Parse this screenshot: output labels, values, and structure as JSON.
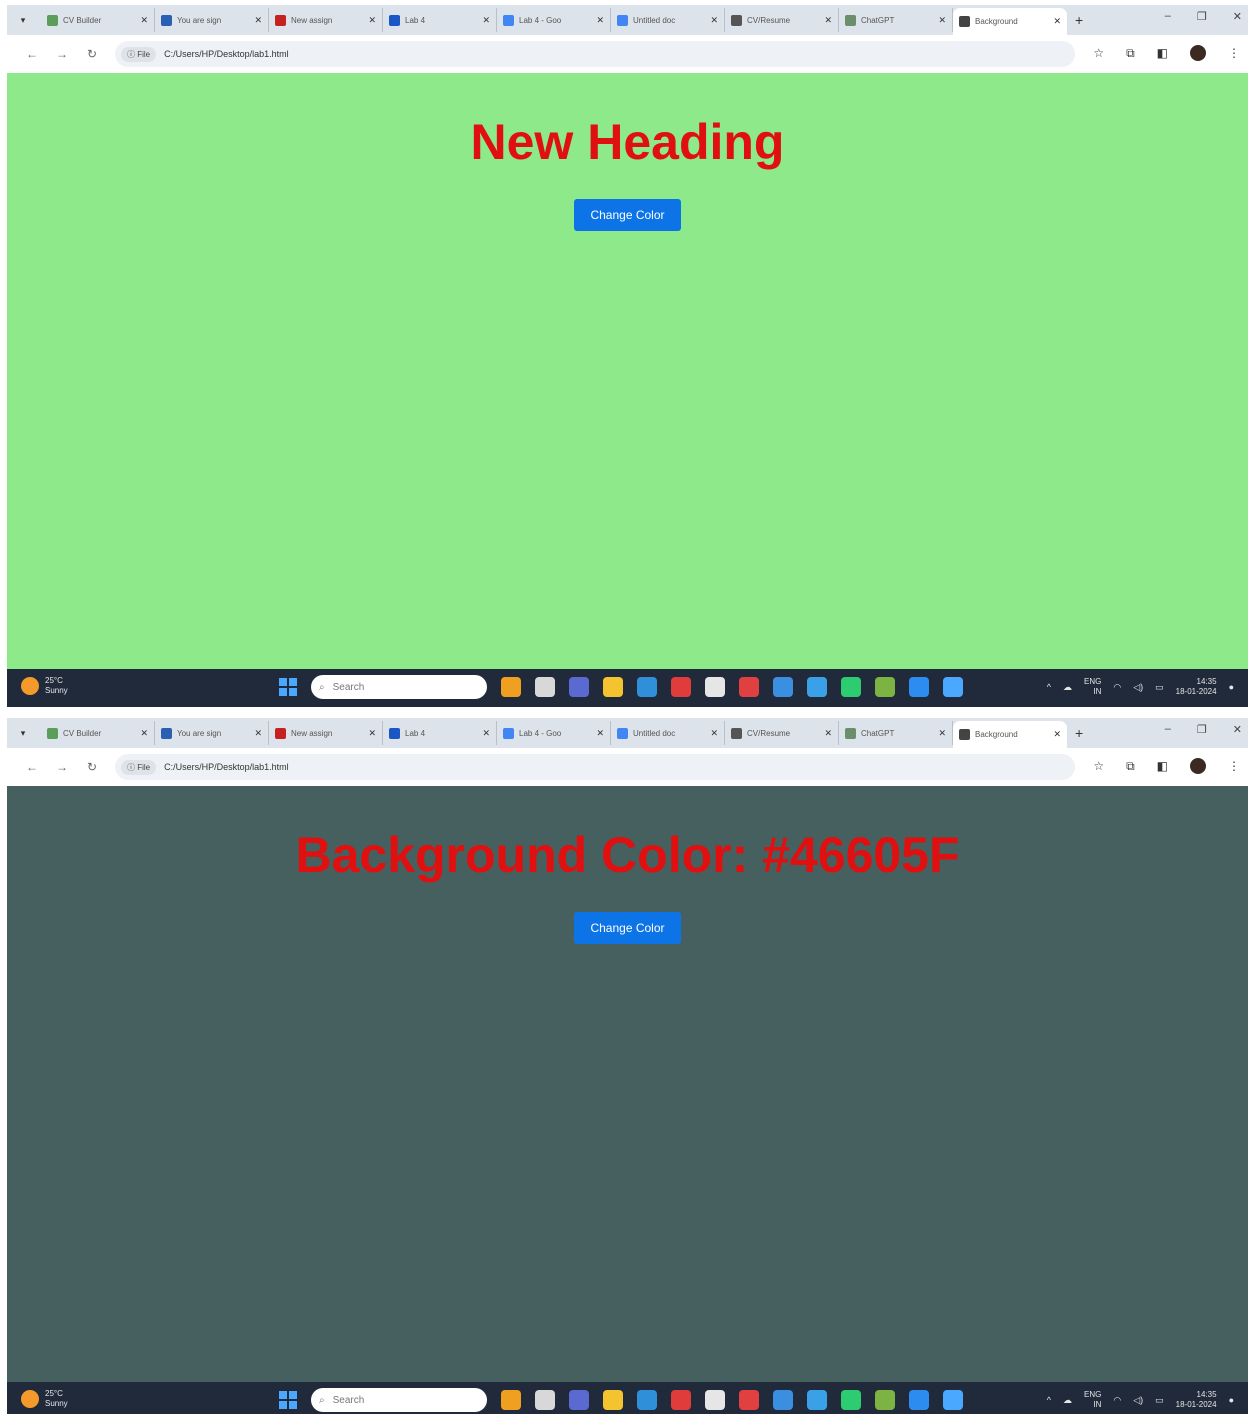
{
  "browser": {
    "tabs": [
      {
        "title": "CV Builder",
        "favicon_color": "#5a9e5a"
      },
      {
        "title": "You are sign",
        "favicon_color": "#2a5fb4"
      },
      {
        "title": "New assign",
        "favicon_color": "#c5221f"
      },
      {
        "title": "Lab 4",
        "favicon_color": "#1a56c4"
      },
      {
        "title": "Lab 4 - Goo",
        "favicon_color": "#4285f4"
      },
      {
        "title": "Untitled doc",
        "favicon_color": "#4285f4"
      },
      {
        "title": "CV/Resume",
        "favicon_color": "#555555"
      },
      {
        "title": "ChatGPT",
        "favicon_color": "#6b8e6b"
      },
      {
        "title": "Background",
        "favicon_color": "#444444"
      }
    ],
    "site_chip": "File",
    "url": "C:/Users/HP/Desktop/lab1.html"
  },
  "screens": [
    {
      "heading": "New Heading",
      "bg_color": "#8ee98a",
      "button_label": "Change Color"
    },
    {
      "heading": "Background Color: #46605F",
      "bg_color": "#46605f",
      "button_label": "Change Color"
    }
  ],
  "taskbar": {
    "temp": "25°C",
    "condition": "Sunny",
    "search_placeholder": "Search",
    "lang_top": "ENG",
    "lang_bottom": "IN",
    "time": "14:35",
    "date": "18-01-2024",
    "app_colors": [
      "#f0a020",
      "#d8d8d8",
      "#5b6ad0",
      "#f4c430",
      "#2f8fd8",
      "#e03c3c",
      "#e6e6e6",
      "#e04040",
      "#3a8fe0",
      "#3aa0e8",
      "#2ecc71",
      "#7cb342",
      "#2d8cf0",
      "#4aa8ff"
    ]
  }
}
